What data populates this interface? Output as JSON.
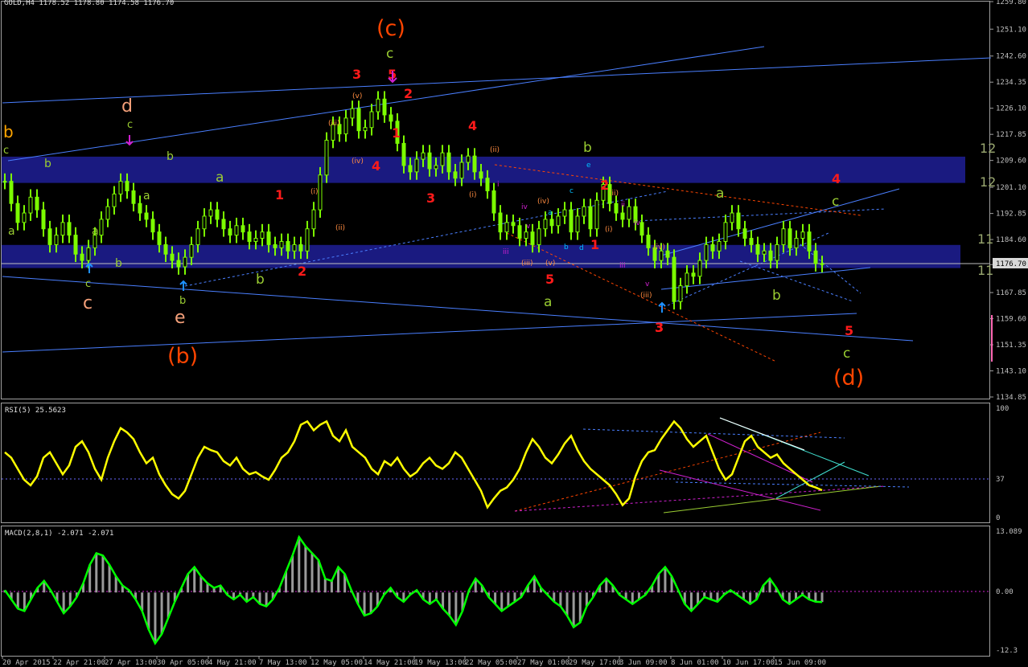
{
  "header": {
    "symbol_line": "GOLD,H4  1178.52 1178.80 1174.58 1176.70",
    "rsi_label": "RSI(5) 25.5623",
    "macd_label": "MACD(2,8,1) -2.071 -2.071"
  },
  "colors": {
    "background": "#000000",
    "price_candle": "#7cfc00",
    "zone": "#1a1a80",
    "rsi_line": "#ffff00",
    "macd_line": "#00ff00",
    "trend_line": "#4a7fff",
    "wave_red": "#ff1a1a",
    "wave_orange": "#ff4500",
    "wave_green": "#9acd32",
    "wave_salmon": "#f4a07a",
    "wave_magenta": "#d020d0"
  },
  "chart_data": [
    {
      "type": "line",
      "name": "price",
      "ylim": [
        1134.85,
        1259.8
      ],
      "price_axis_labels": [
        "1259.80",
        "1251.10",
        "1242.60",
        "1234.35",
        "1226.10",
        "1217.85",
        "1209.60",
        "1201.10",
        "1192.85",
        "1184.60",
        "1176.70",
        "1167.85",
        "1159.60",
        "1151.35",
        "1143.10",
        "1134.85"
      ],
      "current_price": "1176.70",
      "x_labels": [
        "20 Apr 2015",
        "22 Apr 21:00",
        "27 Apr 13:00",
        "30 Apr 05:00",
        "4 May 21:00",
        "7 May 13:00",
        "12 May 05:00",
        "14 May 21:00",
        "19 May 13:00",
        "22 May 05:00",
        "27 May 01:00",
        "29 May 17:00",
        "3 Jun 09:00",
        "8 Jun 01:00",
        "10 Jun 17:00",
        "15 Jun 09:00"
      ],
      "close_series": [
        1203,
        1196,
        1190,
        1193,
        1198,
        1194,
        1188,
        1183,
        1186,
        1190,
        1186,
        1180,
        1178,
        1182,
        1186,
        1191,
        1195,
        1199,
        1203,
        1200,
        1196,
        1193,
        1191,
        1187,
        1183,
        1180,
        1178,
        1176,
        1179,
        1183,
        1188,
        1192,
        1194,
        1191,
        1188,
        1186,
        1189,
        1187,
        1184,
        1185,
        1187,
        1183,
        1182,
        1184,
        1181,
        1183,
        1181,
        1188,
        1194,
        1205,
        1216,
        1221,
        1218,
        1223,
        1226,
        1219,
        1220,
        1225,
        1229,
        1224,
        1222,
        1215,
        1208,
        1206,
        1210,
        1212,
        1207,
        1208,
        1212,
        1206,
        1204,
        1209,
        1211,
        1206,
        1204,
        1200,
        1193,
        1187,
        1190,
        1189,
        1185,
        1187,
        1183,
        1188,
        1191,
        1189,
        1192,
        1194,
        1187,
        1192,
        1195,
        1188,
        1197,
        1202,
        1196,
        1193,
        1191,
        1195,
        1190,
        1186,
        1182,
        1178,
        1181,
        1179,
        1165,
        1170,
        1174,
        1173,
        1178,
        1183,
        1181,
        1184,
        1190,
        1193,
        1188,
        1185,
        1183,
        1180,
        1181,
        1178,
        1183,
        1188,
        1182,
        1185,
        1187,
        1181,
        1177,
        1176.7
      ],
      "upper_zone": [
        1202.5,
        1210.8
      ],
      "lower_zone": [
        1175.6,
        1182.9
      ]
    },
    {
      "type": "line",
      "name": "RSI(5)",
      "ylim": [
        0,
        100
      ],
      "axis_labels": [
        "100",
        "37",
        "0"
      ],
      "level": 37,
      "current": 25.5623,
      "values": [
        60,
        55,
        45,
        35,
        30,
        38,
        55,
        60,
        50,
        40,
        48,
        65,
        70,
        60,
        45,
        35,
        55,
        70,
        82,
        78,
        72,
        60,
        50,
        55,
        40,
        30,
        22,
        18,
        25,
        40,
        55,
        65,
        62,
        60,
        52,
        48,
        55,
        45,
        40,
        42,
        38,
        35,
        44,
        55,
        60,
        70,
        85,
        88,
        80,
        85,
        88,
        75,
        70,
        80,
        65,
        60,
        55,
        45,
        40,
        52,
        48,
        55,
        45,
        38,
        42,
        50,
        55,
        48,
        45,
        50,
        60,
        55,
        45,
        35,
        25,
        10,
        18,
        25,
        28,
        35,
        45,
        60,
        72,
        65,
        55,
        50,
        58,
        68,
        75,
        62,
        52,
        45,
        40,
        35,
        30,
        22,
        12,
        18,
        38,
        52,
        60,
        62,
        72,
        80,
        88,
        82,
        72,
        65,
        70,
        75,
        60,
        45,
        35,
        40,
        55,
        70,
        75,
        65,
        60,
        55,
        58,
        50,
        45,
        40,
        35,
        30,
        28,
        25.56
      ]
    },
    {
      "type": "bar",
      "name": "MACD(2,8,1)",
      "ylim": [
        -12.3,
        13.089
      ],
      "axis_labels": [
        "13.089",
        "0.00",
        "-12.3"
      ],
      "current": -2.071,
      "values": [
        0.5,
        -1.5,
        -3.5,
        -4.0,
        -1.5,
        1.0,
        2.5,
        0.5,
        -2.0,
        -4.5,
        -3.0,
        -1.0,
        2.0,
        6.0,
        8.5,
        8.0,
        6.0,
        3.5,
        1.5,
        0.5,
        -1.5,
        -4.0,
        -8.0,
        -11.0,
        -9.0,
        -5.5,
        -2.0,
        1.0,
        4.0,
        5.5,
        3.5,
        2.0,
        1.0,
        1.5,
        -0.5,
        -1.5,
        -0.5,
        -2.0,
        -1.0,
        -2.5,
        -3.0,
        -1.5,
        1.0,
        4.5,
        8.0,
        12.0,
        10.0,
        8.5,
        7.0,
        3.0,
        2.5,
        5.5,
        4.0,
        0.5,
        -2.5,
        -5.0,
        -4.5,
        -3.0,
        -0.5,
        1.0,
        -1.0,
        -2.0,
        -0.5,
        0.5,
        -1.5,
        -2.5,
        -1.5,
        -3.5,
        -5.0,
        -7.0,
        -4.0,
        0.5,
        3.0,
        1.5,
        -1.0,
        -2.5,
        -4.0,
        -3.0,
        -2.0,
        -1.0,
        1.5,
        3.5,
        1.0,
        -0.5,
        -2.0,
        -3.0,
        -5.0,
        -7.5,
        -6.5,
        -3.0,
        -1.0,
        1.5,
        3.0,
        1.5,
        -0.5,
        -1.5,
        -2.5,
        -1.5,
        -0.5,
        1.5,
        4.0,
        5.5,
        3.5,
        0.5,
        -2.5,
        -4.0,
        -2.5,
        -1.0,
        -1.5,
        -2.0,
        -0.5,
        0.5,
        -0.5,
        -1.5,
        -2.5,
        -1.5,
        1.5,
        3.0,
        1.0,
        -1.5,
        -2.5,
        -1.5,
        -0.5,
        -1.5,
        -2.0,
        -2.071
      ]
    }
  ],
  "wave_labels": {
    "big": [
      {
        "text": "(c)",
        "color": "wave_orange"
      },
      {
        "text": "(b)",
        "color": "wave_orange"
      },
      {
        "text": "(d)",
        "color": "wave_orange"
      }
    ],
    "red": [
      "3",
      "5",
      "2",
      "1",
      "4",
      "4",
      "3",
      "1",
      "2",
      "3",
      "5",
      "2",
      "1",
      "3",
      "4",
      "5"
    ],
    "green": [
      "c",
      "b",
      "c",
      "b",
      "a",
      "a",
      "c",
      "b",
      "a",
      "b",
      "a",
      "b",
      "a",
      "b",
      "c",
      "c",
      "a",
      "c",
      "b",
      "e"
    ],
    "salmon": [
      "d",
      "c",
      "e"
    ],
    "orange_small": [
      "(v)",
      "(iii)",
      "(iv)",
      "(i)",
      "(ii)",
      "(ii)",
      "(i)",
      "(iv)",
      "(iii)",
      "(v)",
      "(ii)",
      "(i)",
      "(iv)",
      "(iii)",
      "i",
      "iv",
      "iii",
      "v",
      "ii",
      "iii",
      "iv",
      "v"
    ],
    "cyan": [
      "e",
      "c",
      "a",
      "b",
      "d"
    ],
    "right_edge": [
      "12",
      "12",
      "11",
      "11"
    ]
  }
}
